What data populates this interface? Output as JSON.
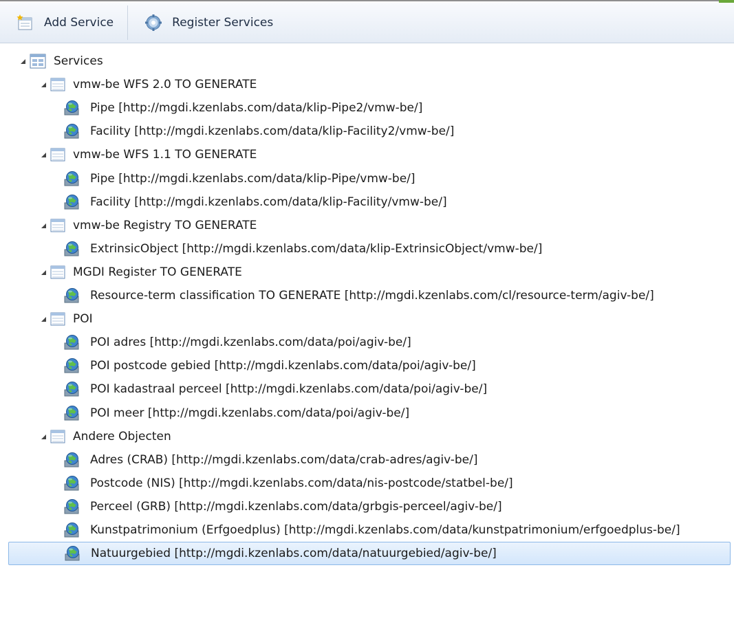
{
  "toolbar": {
    "add_service_label": "Add Service",
    "register_services_label": "Register Services"
  },
  "tree": {
    "root": "Services",
    "groups": [
      {
        "label": "vmw-be WFS 2.0 TO GENERATE",
        "items": [
          "Pipe [http://mgdi.kzenlabs.com/data/klip-Pipe2/vmw-be/]",
          "Facility [http://mgdi.kzenlabs.com/data/klip-Facility2/vmw-be/]"
        ]
      },
      {
        "label": "vmw-be WFS 1.1 TO GENERATE",
        "items": [
          "Pipe [http://mgdi.kzenlabs.com/data/klip-Pipe/vmw-be/]",
          "Facility [http://mgdi.kzenlabs.com/data/klip-Facility/vmw-be/]"
        ]
      },
      {
        "label": "vmw-be Registry TO GENERATE",
        "items": [
          "ExtrinsicObject [http://mgdi.kzenlabs.com/data/klip-ExtrinsicObject/vmw-be/]"
        ]
      },
      {
        "label": "MGDI Register TO GENERATE",
        "items": [
          "Resource-term classification TO GENERATE [http://mgdi.kzenlabs.com/cl/resource-term/agiv-be/]"
        ]
      },
      {
        "label": "POI",
        "items": [
          "POI adres [http://mgdi.kzenlabs.com/data/poi/agiv-be/]",
          "POI postcode gebied [http://mgdi.kzenlabs.com/data/poi/agiv-be/]",
          "POI kadastraal perceel [http://mgdi.kzenlabs.com/data/poi/agiv-be/]",
          "POI meer [http://mgdi.kzenlabs.com/data/poi/agiv-be/]"
        ]
      },
      {
        "label": "Andere Objecten",
        "items": [
          "Adres (CRAB) [http://mgdi.kzenlabs.com/data/crab-adres/agiv-be/]",
          "Postcode (NIS) [http://mgdi.kzenlabs.com/data/nis-postcode/statbel-be/]",
          "Perceel (GRB) [http://mgdi.kzenlabs.com/data/grbgis-perceel/agiv-be/]",
          "Kunstpatrimonium (Erfgoedplus) [http://mgdi.kzenlabs.com/data/kunstpatrimonium/erfgoedplus-be/]",
          "Natuurgebied [http://mgdi.kzenlabs.com/data/natuurgebied/agiv-be/]"
        ]
      }
    ],
    "selected": "Natuurgebied [http://mgdi.kzenlabs.com/data/natuurgebied/agiv-be/]"
  },
  "icons": {
    "add": "add-service-icon",
    "register": "gear-icon",
    "root": "services-folder-icon",
    "group": "table-icon",
    "item": "globe-service-icon"
  },
  "colors": {
    "accent": "#6aa83a",
    "selection": "#d3e6fb",
    "toolbar": "#e5ecf5"
  }
}
